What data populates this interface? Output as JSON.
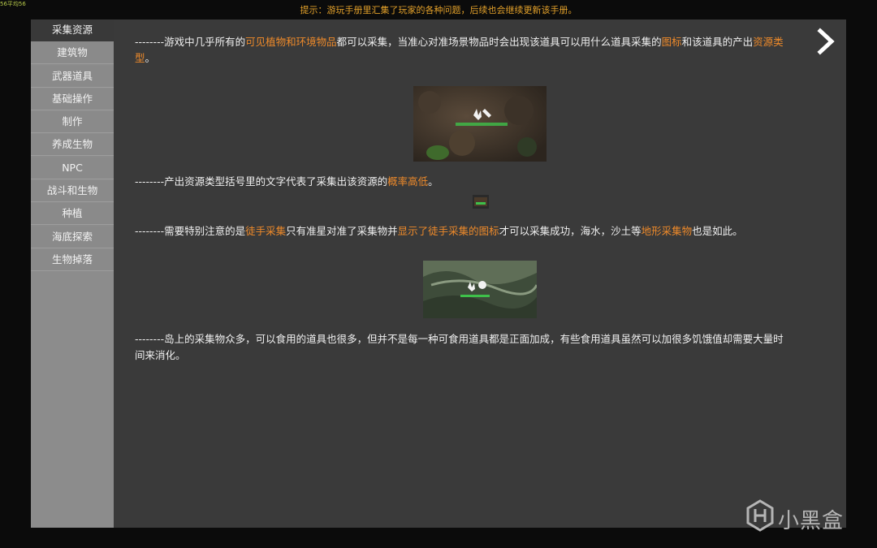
{
  "corner_text": "56平均56",
  "hint": "提示：游玩手册里汇集了玩家的各种问题，后续也会继续更新该手册。",
  "sidebar": {
    "items": [
      {
        "label": "采集资源",
        "active": true
      },
      {
        "label": "建筑物"
      },
      {
        "label": "武器道具"
      },
      {
        "label": "基础操作"
      },
      {
        "label": "制作"
      },
      {
        "label": "养成生物"
      },
      {
        "label": "NPC"
      },
      {
        "label": "战斗和生物"
      },
      {
        "label": "种植"
      },
      {
        "label": "海底探索"
      },
      {
        "label": "生物掉落"
      }
    ]
  },
  "content": {
    "p1": [
      {
        "t": "--------游戏中几乎所有的"
      },
      {
        "t": "可见植物和环境物品",
        "hl": true
      },
      {
        "t": "都可以采集，当准心对准场景物品时会出现该道具可以用什么道具采集的"
      },
      {
        "t": "图标",
        "hl": true
      },
      {
        "t": "和该道具的产出"
      },
      {
        "t": "资源类型",
        "hl": true
      },
      {
        "t": "。"
      }
    ],
    "p2": [
      {
        "t": "--------产出资源类型括号里的文字代表了采集出该资源的"
      },
      {
        "t": "概率高低",
        "hl": true
      },
      {
        "t": "。"
      }
    ],
    "p3": [
      {
        "t": "--------需要特别注意的是"
      },
      {
        "t": "徒手采集",
        "hl": true
      },
      {
        "t": "只有准星对准了采集物并"
      },
      {
        "t": "显示了徒手采集的图标",
        "hl": true
      },
      {
        "t": "才可以采集成功，海水，沙土等"
      },
      {
        "t": "地形采集物",
        "hl": true
      },
      {
        "t": "也是如此。"
      }
    ],
    "p4": [
      {
        "t": "--------岛上的采集物众多，可以食用的道具也很多，但并不是每一种可食用道具都是正面加成，有些食用道具虽然可以加很多饥饿值却需要大量时间来消化。"
      }
    ]
  },
  "images": {
    "img1_caption": "",
    "img3_caption": ""
  },
  "colors": {
    "highlight": "#ee8a2a",
    "hint": "#e2a02a",
    "panel": "#3a3a3a",
    "sidebar": "#8c8c8c"
  },
  "icons": {
    "next": "chevron-right-icon",
    "logo": "xiaoheihe-logo-icon"
  },
  "logo_text": "小黑盒"
}
